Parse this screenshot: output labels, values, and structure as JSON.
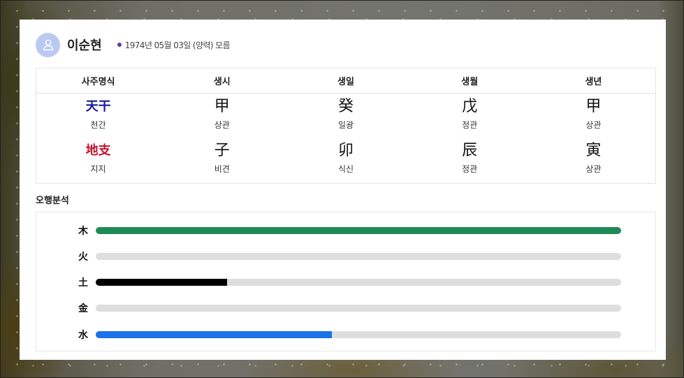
{
  "profile": {
    "name": "이순현",
    "birth": "1974년 05월 03일 (양력) 모름"
  },
  "saju": {
    "headers": [
      "사주명식",
      "생시",
      "생일",
      "생월",
      "생년"
    ],
    "rows": [
      {
        "label": "天干",
        "label_sub": "천간",
        "label_color": "#1a1a9c",
        "cells": [
          {
            "char": "甲",
            "sub": "상관"
          },
          {
            "char": "癸",
            "sub": "일광"
          },
          {
            "char": "戊",
            "sub": "정관"
          },
          {
            "char": "甲",
            "sub": "상관"
          }
        ]
      },
      {
        "label": "地支",
        "label_sub": "지지",
        "label_color": "#c4122f",
        "cells": [
          {
            "char": "子",
            "sub": "비견"
          },
          {
            "char": "卯",
            "sub": "식신"
          },
          {
            "char": "辰",
            "sub": "정관"
          },
          {
            "char": "寅",
            "sub": "상관"
          }
        ]
      }
    ]
  },
  "ohaeng": {
    "title": "오행분석",
    "elements": [
      {
        "label": "木",
        "fraction": 1.0,
        "color": "#1e8a57"
      },
      {
        "label": "火",
        "fraction": 0.0,
        "color": "#d33a2c"
      },
      {
        "label": "土",
        "fraction": 0.25,
        "color": "#000000"
      },
      {
        "label": "金",
        "fraction": 0.0,
        "color": "#9a9a9a"
      },
      {
        "label": "水",
        "fraction": 0.45,
        "color": "#1a73e8"
      }
    ]
  },
  "icons": {
    "avatar": "user-icon"
  }
}
